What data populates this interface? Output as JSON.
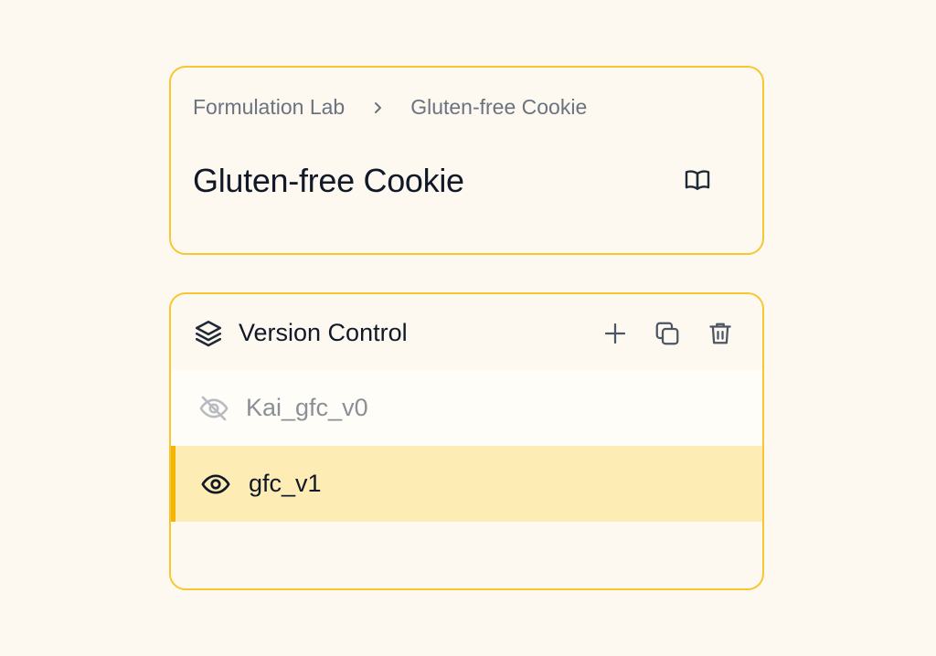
{
  "breadcrumb": {
    "items": [
      "Formulation Lab",
      "Gluten-free Cookie"
    ]
  },
  "header": {
    "title": "Gluten-free Cookie",
    "doc_icon": "book-open-icon"
  },
  "version_control": {
    "title": "Version Control",
    "icons": {
      "section": "layers-icon",
      "add": "plus-icon",
      "duplicate": "copy-icon",
      "delete": "trash-icon"
    },
    "versions": [
      {
        "name": "Kai_gfc_v0",
        "visible": false,
        "active": false
      },
      {
        "name": "gfc_v1",
        "visible": true,
        "active": true
      }
    ]
  },
  "colors": {
    "accent_border": "#f8c630",
    "active_row": "#feecb5",
    "active_bar": "#f5b400",
    "background": "#fdf9f0"
  }
}
